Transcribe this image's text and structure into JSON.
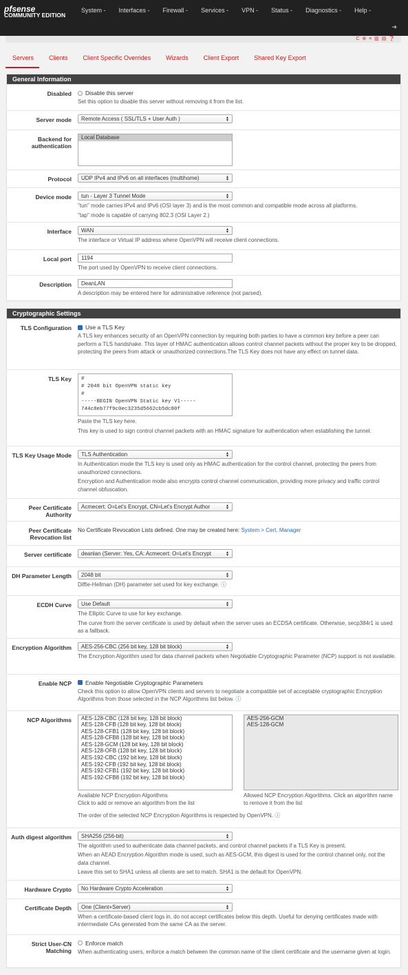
{
  "navbar": {
    "logo_brand": "pfsense",
    "logo_edition": "COMMUNITY EDITION",
    "menu": [
      "System -",
      "Interfaces -",
      "Firewall -",
      "Services -",
      "VPN -",
      "Status -",
      "Diagnostics -",
      "Help -"
    ],
    "logout_icon": "sign-out-icon"
  },
  "breadcrumb": {
    "icons": "C ⊕ ≡ ▥ ▤ ❓"
  },
  "tabs": [
    "Servers",
    "Clients",
    "Client Specific Overrides",
    "Wizards",
    "Client Export",
    "Shared Key Export"
  ],
  "active_tab": 0,
  "general": {
    "title": "General Information",
    "disabled": {
      "label": "Disabled",
      "check": "Disable this server",
      "checked": false,
      "help": "Set this option to disable this server without removing it from the list."
    },
    "server_mode": {
      "label": "Server mode",
      "value": "Remote Access ( SSL/TLS + User Auth )"
    },
    "backend": {
      "label": "Backend for authentication",
      "value": "Local Database"
    },
    "protocol": {
      "label": "Protocol",
      "value": "UDP IPv4 and IPv6 on all interfaces (multihome)"
    },
    "device_mode": {
      "label": "Device mode",
      "value": "tun - Layer 3 Tunnel Mode",
      "help1": "\"tun\" mode carries IPv4 and IPv6 (OSI layer 3) and is the most common and compatible mode across all platforms.",
      "help2": "\"tap\" mode is capable of carrying 802.3 (OSI Layer 2.)"
    },
    "interface": {
      "label": "Interface",
      "value": "WAN",
      "help": "The interface or Virtual IP address where OpenVPN will receive client connections."
    },
    "local_port": {
      "label": "Local port",
      "value": "1194",
      "help": "The port used by OpenVPN to receive client connections."
    },
    "description": {
      "label": "Description",
      "value": "DeanLAN",
      "help": "A description may be entered here for administrative reference (not parsed)."
    }
  },
  "crypto": {
    "title": "Cryptographic Settings",
    "tls_config": {
      "label": "TLS Configuration",
      "check": "Use a TLS Key",
      "checked": true,
      "help": "A TLS key enhances security of an OpenVPN connection by requiring both parties to have a common key before a peer can perform a TLS handshake. This layer of HMAC authentication allows control channel packets without the proper key to be dropped, protecting the peers from attack or unauthorized connections.The TLS Key does not have any effect on tunnel data."
    },
    "tls_key": {
      "label": "TLS Key",
      "value": "#\n# 2048 bit OpenVPN static key\n#\n-----BEGIN OpenVPN Static key V1-----\n744c8eb77f9c0ec3235d5662cb5dc80f",
      "help1": "Paste the TLS key here.",
      "help2": "This key is used to sign control channel packets with an HMAC signature for authentication when establishing the tunnel."
    },
    "tls_usage": {
      "label": "TLS Key Usage Mode",
      "value": "TLS Authentication",
      "help1": "In Authentication mode the TLS key is used only as HMAC authentication for the control channel, protecting the peers from unauthorized connections.",
      "help2": "Encryption and Authentication mode also encrypts control channel communication, providing more privacy and traffic control channel obfuscation."
    },
    "peer_ca": {
      "label": "Peer Certificate Authority",
      "value": "Acmecert: O=Let's Encrypt, CN=Let's Encrypt Author"
    },
    "peer_crl": {
      "label": "Peer Certificate Revocation list",
      "text": "No Certificate Revocation Lists defined. One may be created here: ",
      "link": "System > Cert. Manager"
    },
    "server_cert": {
      "label": "Server certificate",
      "value": "deanlan (Server: Yes, CA: Acmecert: O=Let's Encrypt"
    },
    "dh": {
      "label": "DH Parameter Length",
      "value": "2048 bit",
      "help": "Diffie-Hellman (DH) parameter set used for key exchange."
    },
    "ecdh": {
      "label": "ECDH Curve",
      "value": "Use Default",
      "help1": "The Elliptic Curve to use for key exchange.",
      "help2": "The curve from the server certificate is used by default when the server uses an ECDSA certificate. Otherwise, secp384r1 is used as a fallback."
    },
    "encryption": {
      "label": "Encryption Algorithm",
      "value": "AES-256-CBC (256 bit key, 128 bit block)",
      "help": "The Encryption Algorithm used for data channel packets when Negotiable Cryptographic Parameter (NCP) support is not available."
    },
    "ncp": {
      "label": "Enable NCP",
      "check": "Enable Negotiable Cryptographic Parameters",
      "checked": true,
      "help": "Check this option to allow OpenVPN clients and servers to negotiate a compatible set of acceptable cryptographic Encryption Algorithms from those selected in the NCP Algorithms list below."
    },
    "ncp_algs": {
      "label": "NCP Algorithms",
      "available": [
        "AES-128-CBC (128 bit key, 128 bit block)",
        "AES-128-CFB (128 bit key, 128 bit block)",
        "AES-128-CFB1 (128 bit key, 128 bit block)",
        "AES-128-CFB8 (128 bit key, 128 bit block)",
        "AES-128-GCM (128 bit key, 128 bit block)",
        "AES-128-OFB (128 bit key, 128 bit block)",
        "AES-192-CBC (192 bit key, 128 bit block)",
        "AES-192-CFB (192 bit key, 128 bit block)",
        "AES-192-CFB1 (192 bit key, 128 bit block)",
        "AES-192-CFB8 (192 bit key, 128 bit block)"
      ],
      "allowed": [
        "AES-256-GCM",
        "AES-128-GCM"
      ],
      "help_avail1": "Available NCP Encryption Algorithms",
      "help_avail2": "Click to add or remove an algorithm from the list",
      "help_allowed": "Allowed NCP Encryption Algorithms. Click an algorithm name to remove it from the list",
      "help_order": "The order of the selected NCP Encryption Algorithms is respected by OpenVPN."
    },
    "auth_digest": {
      "label": "Auth digest algorithm",
      "value": "SHA256 (256-bit)",
      "help1": "The algorithm used to authenticate data channel packets, and control channel packets if a TLS Key is present.",
      "help2": "When an AEAD Encryption Algorithm mode is used, such as AES-GCM, this digest is used for the control channel only, not the data channel.",
      "help3": "Leave this set to SHA1 unless all clients are set to match. SHA1 is the default for OpenVPN."
    },
    "hw_crypto": {
      "label": "Hardware Crypto",
      "value": "No Hardware Crypto Acceleration"
    },
    "cert_depth": {
      "label": "Certificate Depth",
      "value": "One (Client+Server)",
      "help": "When a certificate-based client logs in, do not accept certificates below this depth. Useful for denying certificates made with intermediate CAs generated from the same CA as the server."
    },
    "strict_cn": {
      "label": "Strict User-CN Matching",
      "check": "Enforce match",
      "checked": false,
      "help": "When authenticating users, enforce a match between the common name of the client certificate and the username given at login."
    }
  }
}
